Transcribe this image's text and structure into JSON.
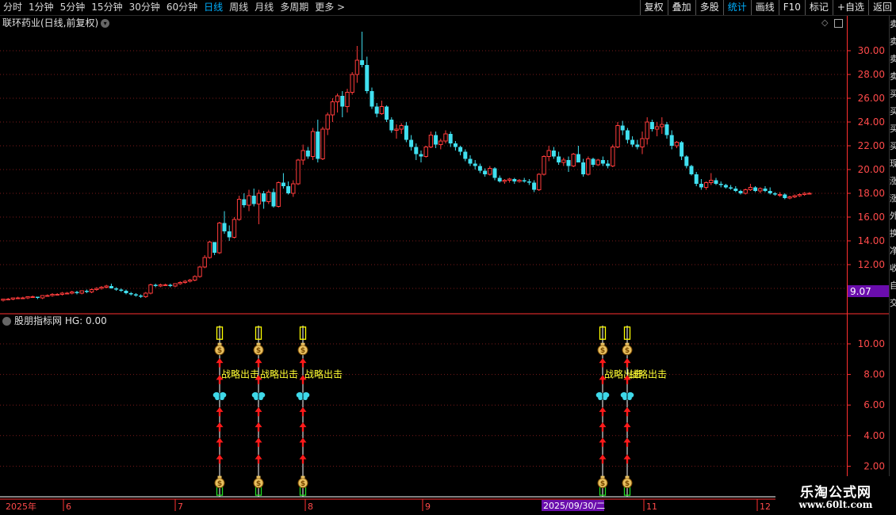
{
  "top_bar": {
    "periods": [
      {
        "label": "分时",
        "active": false
      },
      {
        "label": "1分钟",
        "active": false
      },
      {
        "label": "5分钟",
        "active": false
      },
      {
        "label": "15分钟",
        "active": false
      },
      {
        "label": "30分钟",
        "active": false
      },
      {
        "label": "60分钟",
        "active": false
      },
      {
        "label": "日线",
        "active": true
      },
      {
        "label": "周线",
        "active": false
      },
      {
        "label": "月线",
        "active": false
      },
      {
        "label": "多周期",
        "active": false
      },
      {
        "label": "更多 >",
        "active": false
      }
    ],
    "tools": [
      {
        "label": "复权",
        "active": false
      },
      {
        "label": "叠加",
        "active": false
      },
      {
        "label": "多股",
        "active": false
      },
      {
        "label": "统计",
        "active": true
      },
      {
        "label": "画线",
        "active": false
      },
      {
        "label": "F10",
        "active": false
      },
      {
        "label": "标记",
        "active": false
      },
      {
        "label": "+自选",
        "active": false
      },
      {
        "label": "返回",
        "active": false
      }
    ]
  },
  "main_chart": {
    "title": "联环药业(日线,前复权)",
    "price_axis": [
      "30.00",
      "28.00",
      "26.00",
      "24.00",
      "22.00",
      "20.00",
      "18.00",
      "16.00",
      "14.00",
      "12.00"
    ],
    "current_price_badge": "9.07"
  },
  "indicator": {
    "title": "股朋指标网 HG: 0.00",
    "axis": [
      "10.00",
      "8.00",
      "6.00",
      "4.00",
      "2.00"
    ],
    "signal_label": "战略出击",
    "colors": {
      "arrow": "#ff1a1a",
      "butterfly": "#3fd8e8",
      "text": "#ffff33",
      "bar_top": "#ffff00",
      "bar_bottom": "#22dd22"
    }
  },
  "date_axis": {
    "labels": [
      "2025年",
      "6",
      "7",
      "8",
      "9",
      "10",
      "11",
      "12"
    ],
    "cursor_date": "2025/09/30/二"
  },
  "colors": {
    "up": "#ff3b3b",
    "down": "#40e0f0",
    "grid": "#7a1a1a",
    "axis": "#ff3030",
    "badge": "#6a0dad"
  },
  "chart_data": [
    {
      "type": "candlestick",
      "title": "联环药业(日线,前复权)",
      "y_range": [
        9,
        32
      ],
      "up_color": "#ff3b3b",
      "down_color": "#40e0f0",
      "candles": [
        [
          9.0,
          9.1,
          8.9,
          9.1
        ],
        [
          9.1,
          9.2,
          9.0,
          9.1
        ],
        [
          9.1,
          9.2,
          9.0,
          9.2
        ],
        [
          9.2,
          9.3,
          9.1,
          9.2
        ],
        [
          9.2,
          9.3,
          9.1,
          9.2
        ],
        [
          9.2,
          9.3,
          9.1,
          9.3
        ],
        [
          9.3,
          9.4,
          9.2,
          9.3
        ],
        [
          9.3,
          9.3,
          9.1,
          9.2
        ],
        [
          9.2,
          9.4,
          9.1,
          9.4
        ],
        [
          9.4,
          9.5,
          9.3,
          9.4
        ],
        [
          9.4,
          9.6,
          9.3,
          9.5
        ],
        [
          9.5,
          9.6,
          9.4,
          9.5
        ],
        [
          9.5,
          9.7,
          9.4,
          9.6
        ],
        [
          9.6,
          9.7,
          9.5,
          9.6
        ],
        [
          9.6,
          9.8,
          9.5,
          9.7
        ],
        [
          9.7,
          9.8,
          9.5,
          9.6
        ],
        [
          9.6,
          9.8,
          9.5,
          9.8
        ],
        [
          9.8,
          9.9,
          9.6,
          9.7
        ],
        [
          9.7,
          10.0,
          9.6,
          9.9
        ],
        [
          9.9,
          10.1,
          9.8,
          10.0
        ],
        [
          10.0,
          10.2,
          9.9,
          10.1
        ],
        [
          10.1,
          10.3,
          10.0,
          10.2
        ],
        [
          10.2,
          10.4,
          10.0,
          10.0
        ],
        [
          10.0,
          10.1,
          9.8,
          9.9
        ],
        [
          9.9,
          10.0,
          9.7,
          9.8
        ],
        [
          9.8,
          9.9,
          9.5,
          9.6
        ],
        [
          9.6,
          9.7,
          9.4,
          9.5
        ],
        [
          9.5,
          9.6,
          9.3,
          9.4
        ],
        [
          9.4,
          9.5,
          9.2,
          9.3
        ],
        [
          9.3,
          9.7,
          9.2,
          9.6
        ],
        [
          9.6,
          10.4,
          9.5,
          10.3
        ],
        [
          10.3,
          10.4,
          10.1,
          10.2
        ],
        [
          10.2,
          10.4,
          10.1,
          10.3
        ],
        [
          10.3,
          10.4,
          10.2,
          10.3
        ],
        [
          10.3,
          10.4,
          10.1,
          10.2
        ],
        [
          10.2,
          10.4,
          10.1,
          10.4
        ],
        [
          10.4,
          10.6,
          10.3,
          10.5
        ],
        [
          10.5,
          10.7,
          10.4,
          10.6
        ],
        [
          10.6,
          10.8,
          10.5,
          10.7
        ],
        [
          10.7,
          11.1,
          10.6,
          11.0
        ],
        [
          11.0,
          11.9,
          10.9,
          11.8
        ],
        [
          11.8,
          12.8,
          11.7,
          12.6
        ],
        [
          12.6,
          14.0,
          12.5,
          13.9
        ],
        [
          13.9,
          13.9,
          12.8,
          13.0
        ],
        [
          13.0,
          15.6,
          12.9,
          15.5
        ],
        [
          15.5,
          16.5,
          14.6,
          14.8
        ],
        [
          14.8,
          15.3,
          14.0,
          14.3
        ],
        [
          14.3,
          16.0,
          14.2,
          15.8
        ],
        [
          15.8,
          17.8,
          15.7,
          17.5
        ],
        [
          17.5,
          18.0,
          16.8,
          17.0
        ],
        [
          17.0,
          18.3,
          16.5,
          17.8
        ],
        [
          17.8,
          18.4,
          16.9,
          17.1
        ],
        [
          17.1,
          18.3,
          15.4,
          18.0
        ],
        [
          18.0,
          18.2,
          16.7,
          17.3
        ],
        [
          17.3,
          18.3,
          17.1,
          18.1
        ],
        [
          18.1,
          18.4,
          16.8,
          16.9
        ],
        [
          16.9,
          19.0,
          16.8,
          18.9
        ],
        [
          18.9,
          19.7,
          18.4,
          18.6
        ],
        [
          18.6,
          19.0,
          17.9,
          18.0
        ],
        [
          18.0,
          19.1,
          17.7,
          18.8
        ],
        [
          18.8,
          20.9,
          18.7,
          20.8
        ],
        [
          20.8,
          22.1,
          20.4,
          21.6
        ],
        [
          21.6,
          21.9,
          20.9,
          21.1
        ],
        [
          21.1,
          23.5,
          20.8,
          23.2
        ],
        [
          23.2,
          24.2,
          20.6,
          20.9
        ],
        [
          20.9,
          23.6,
          20.8,
          23.4
        ],
        [
          23.4,
          24.8,
          22.9,
          24.6
        ],
        [
          24.6,
          26.0,
          24.0,
          25.7
        ],
        [
          25.7,
          26.4,
          24.8,
          26.2
        ],
        [
          26.2,
          26.6,
          24.4,
          25.3
        ],
        [
          25.3,
          26.8,
          24.8,
          26.5
        ],
        [
          26.5,
          28.2,
          26.3,
          28.0
        ],
        [
          28.0,
          30.4,
          27.3,
          29.2
        ],
        [
          29.2,
          31.6,
          28.6,
          28.8
        ],
        [
          28.8,
          29.5,
          26.4,
          26.6
        ],
        [
          26.6,
          26.9,
          25.1,
          25.3
        ],
        [
          25.3,
          25.6,
          24.4,
          24.7
        ],
        [
          24.7,
          25.8,
          24.6,
          25.3
        ],
        [
          25.3,
          25.4,
          24.0,
          24.2
        ],
        [
          24.2,
          24.4,
          23.1,
          23.3
        ],
        [
          23.3,
          23.8,
          22.6,
          23.4
        ],
        [
          23.4,
          23.9,
          23.0,
          23.7
        ],
        [
          23.7,
          24.0,
          22.3,
          22.5
        ],
        [
          22.5,
          22.9,
          21.6,
          21.9
        ],
        [
          21.9,
          22.2,
          20.8,
          21.3
        ],
        [
          21.3,
          21.6,
          20.6,
          21.1
        ],
        [
          21.1,
          22.0,
          21.0,
          21.9
        ],
        [
          21.9,
          23.2,
          21.8,
          22.9
        ],
        [
          22.9,
          23.2,
          21.8,
          22.1
        ],
        [
          22.1,
          22.6,
          21.7,
          22.4
        ],
        [
          22.4,
          23.3,
          22.2,
          23.0
        ],
        [
          23.0,
          23.2,
          21.9,
          22.2
        ],
        [
          22.2,
          22.4,
          21.6,
          21.9
        ],
        [
          21.9,
          22.0,
          21.2,
          21.5
        ],
        [
          21.5,
          21.7,
          20.7,
          20.9
        ],
        [
          20.9,
          21.2,
          20.3,
          20.5
        ],
        [
          20.5,
          20.8,
          20.0,
          20.3
        ],
        [
          20.3,
          20.5,
          19.7,
          19.9
        ],
        [
          19.9,
          20.1,
          19.4,
          19.6
        ],
        [
          19.6,
          20.3,
          19.5,
          20.1
        ],
        [
          20.1,
          20.2,
          19.1,
          19.3
        ],
        [
          19.3,
          19.5,
          18.9,
          19.0
        ],
        [
          19.0,
          19.2,
          18.8,
          19.1
        ],
        [
          19.1,
          19.3,
          18.9,
          19.2
        ],
        [
          19.2,
          19.3,
          18.8,
          19.0
        ],
        [
          19.0,
          19.2,
          18.9,
          19.1
        ],
        [
          19.1,
          19.3,
          18.9,
          19.0
        ],
        [
          19.0,
          19.2,
          18.7,
          18.9
        ],
        [
          18.9,
          19.1,
          18.1,
          18.3
        ],
        [
          18.3,
          19.7,
          18.2,
          19.6
        ],
        [
          19.6,
          21.2,
          19.5,
          21.1
        ],
        [
          21.1,
          22.0,
          20.7,
          21.6
        ],
        [
          21.6,
          21.9,
          20.9,
          21.1
        ],
        [
          21.1,
          21.5,
          20.4,
          20.6
        ],
        [
          20.6,
          21.0,
          20.3,
          20.8
        ],
        [
          20.8,
          21.1,
          19.8,
          20.3
        ],
        [
          20.3,
          21.4,
          20.2,
          21.3
        ],
        [
          21.3,
          22.0,
          20.9,
          20.6
        ],
        [
          20.6,
          20.9,
          19.4,
          19.6
        ],
        [
          19.6,
          21.1,
          19.5,
          20.9
        ],
        [
          20.9,
          21.0,
          20.2,
          20.4
        ],
        [
          20.4,
          20.9,
          20.3,
          20.8
        ],
        [
          20.8,
          21.1,
          20.3,
          20.5
        ],
        [
          20.5,
          20.8,
          20.1,
          20.3
        ],
        [
          20.3,
          22.1,
          20.2,
          21.9
        ],
        [
          21.9,
          24.0,
          21.8,
          23.7
        ],
        [
          23.7,
          24.1,
          22.9,
          23.3
        ],
        [
          23.3,
          23.5,
          22.2,
          22.5
        ],
        [
          22.5,
          22.8,
          21.9,
          22.1
        ],
        [
          22.1,
          22.5,
          21.7,
          21.9
        ],
        [
          21.9,
          23.2,
          21.3,
          22.6
        ],
        [
          22.6,
          24.4,
          22.1,
          24.0
        ],
        [
          24.0,
          24.2,
          23.2,
          23.4
        ],
        [
          23.4,
          24.0,
          22.8,
          23.6
        ],
        [
          23.6,
          24.4,
          23.0,
          23.8
        ],
        [
          23.8,
          24.0,
          22.6,
          22.9
        ],
        [
          22.9,
          23.3,
          21.7,
          22.0
        ],
        [
          22.0,
          22.4,
          21.8,
          22.3
        ],
        [
          22.3,
          22.4,
          20.8,
          21.1
        ],
        [
          21.1,
          21.2,
          20.1,
          20.3
        ],
        [
          20.3,
          20.4,
          19.5,
          19.6
        ],
        [
          19.6,
          19.8,
          18.6,
          18.8
        ],
        [
          18.8,
          19.2,
          18.3,
          18.5
        ],
        [
          18.5,
          19.0,
          18.3,
          18.9
        ],
        [
          18.9,
          19.7,
          18.7,
          19.1
        ],
        [
          19.1,
          19.3,
          18.7,
          18.8
        ],
        [
          18.8,
          19.0,
          18.5,
          18.7
        ],
        [
          18.7,
          18.8,
          18.4,
          18.5
        ],
        [
          18.5,
          18.7,
          18.3,
          18.4
        ],
        [
          18.4,
          18.6,
          18.1,
          18.2
        ],
        [
          18.2,
          18.3,
          17.9,
          18.0
        ],
        [
          18.0,
          18.4,
          17.9,
          18.3
        ],
        [
          18.3,
          18.8,
          18.2,
          18.5
        ],
        [
          18.5,
          18.6,
          18.1,
          18.2
        ],
        [
          18.2,
          18.5,
          18.0,
          18.4
        ],
        [
          18.4,
          18.6,
          18.1,
          18.2
        ],
        [
          18.2,
          18.5,
          17.9,
          18.0
        ],
        [
          18.0,
          18.1,
          17.8,
          17.9
        ],
        [
          17.9,
          18.1,
          17.7,
          17.9
        ],
        [
          17.9,
          18.0,
          17.5,
          17.6
        ],
        [
          17.6,
          17.8,
          17.5,
          17.7
        ],
        [
          17.7,
          17.9,
          17.6,
          17.8
        ],
        [
          17.8,
          18.0,
          17.7,
          17.9
        ],
        [
          17.9,
          18.1,
          17.8,
          18.0
        ],
        [
          18.0,
          18.1,
          17.9,
          18.0
        ]
      ]
    },
    {
      "type": "signal-markers",
      "title": "股朋指标网 HG: 0.00",
      "y_range": [
        0,
        11.5
      ],
      "signal_candle_index": [
        44,
        52,
        61,
        122,
        127
      ],
      "annotation": "战略出击"
    }
  ]
}
